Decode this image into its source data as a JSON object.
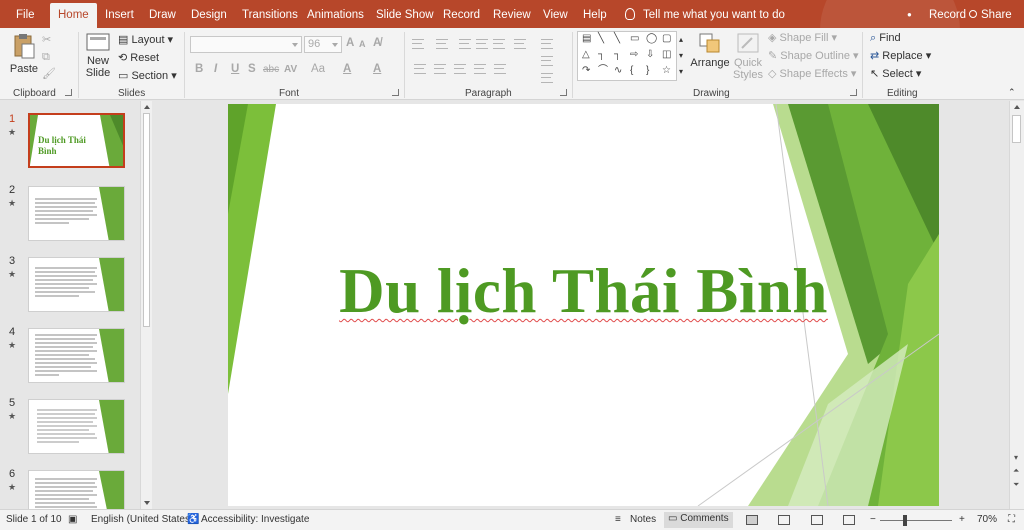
{
  "tabs": [
    "File",
    "Home",
    "Insert",
    "Draw",
    "Design",
    "Transitions",
    "Animations",
    "Slide Show",
    "Record",
    "Review",
    "View",
    "Help"
  ],
  "tell_me": "Tell me what you want to do",
  "record_right": "Record",
  "share": "Share",
  "ribbon": {
    "clipboard": {
      "paste": "Paste",
      "label": "Clipboard"
    },
    "slides": {
      "new_slide_1": "New",
      "new_slide_2": "Slide",
      "layout": "Layout",
      "reset": "Reset",
      "section": "Section",
      "label": "Slides"
    },
    "font": {
      "size": "96",
      "label": "Font",
      "buttons": [
        "A",
        "A",
        "A̸",
        "B",
        "I",
        "U",
        "S",
        "abc",
        "AV",
        "Aa",
        "A",
        "A"
      ]
    },
    "paragraph": {
      "label": "Paragraph"
    },
    "drawing": {
      "arrange": "Arrange",
      "quick_styles_1": "Quick",
      "quick_styles_2": "Styles",
      "shape_fill": "Shape Fill",
      "shape_outline": "Shape Outline",
      "shape_effects": "Shape Effects",
      "label": "Drawing"
    },
    "editing": {
      "find": "Find",
      "replace": "Replace",
      "select": "Select",
      "label": "Editing"
    }
  },
  "slide_panel": {
    "numbers": [
      "1",
      "2",
      "3",
      "4",
      "5",
      "6"
    ],
    "star": "★",
    "thumb1_title_1": "Du lịch Thái",
    "thumb1_title_2": "Bình"
  },
  "slide": {
    "title": "Du lịch Thái Bình"
  },
  "status": {
    "slide_info": "Slide 1 of 10",
    "language": "English (United States)",
    "accessibility": "Accessibility: Investigate",
    "notes": "Notes",
    "comments": "Comments",
    "zoom": "70%"
  },
  "colors": {
    "accent": "#b7472a",
    "title_green": "#4e9a23"
  }
}
